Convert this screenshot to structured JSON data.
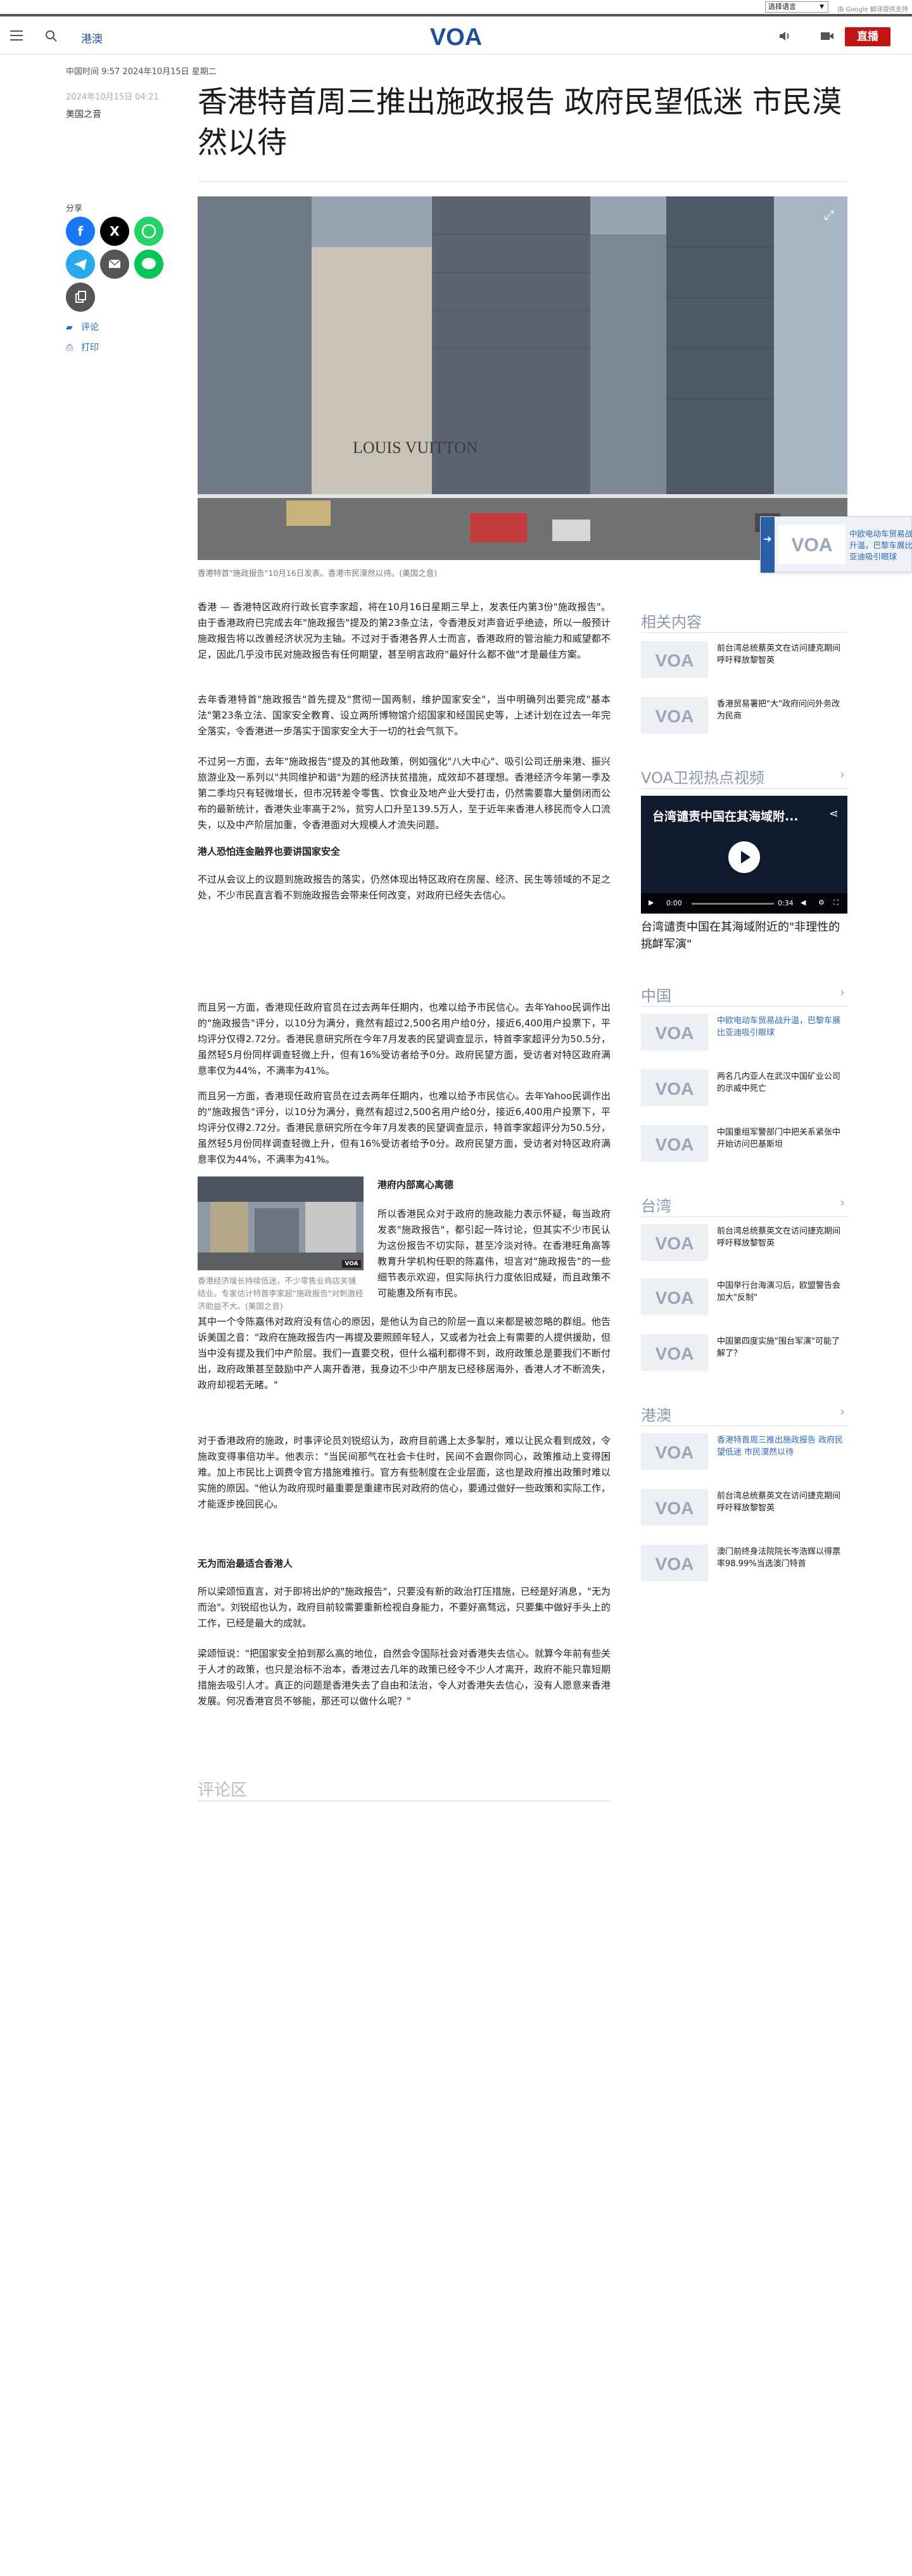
{
  "topbar": {
    "language_select": "选择语言",
    "powered_by": "由 Google 翻译提供支持"
  },
  "header": {
    "section": "港澳",
    "logo_text": "VOA",
    "live_label": "直播"
  },
  "article": {
    "meta_time": "中国时间 9:57 2024年10月15日 星期二",
    "date": "2024年10月15日 04:21",
    "byline": "美国之音",
    "headline": "香港特首周三推出施政报告 政府民望低迷 市民漠然以待",
    "hero_caption": "香港特首\"施政报告\"10月16日发表。香港市民漠然以待。(美国之音)",
    "inline_caption": "香港经济增长持续低迷，不少零售业商店关铺结业。专家估计特首李家超\"施政报告\"对刺激经济助益不大。(美国之音)",
    "paragraphs": [
      "香港 — 香港特区政府行政长官李家超，将在10月16日星期三早上，发表任内第3份\"施政报告\"。由于香港政府已完成去年\"施政报告\"提及的第23条立法，令香港反对声音近乎绝迹，所以一般预计施政报告将以改善经济状况为主轴。不过对于香港各界人士而言，香港政府的管治能力和威望都不足，因此几乎没市民对施政报告有任何期望，甚至明言政府\"最好什么都不做\"才是最佳方案。",
      "去年香港特首\"施政报告\"首先提及\"贯彻一国两制，维护国家安全\"，当中明确列出要完成\"基本法\"第23条立法、国家安全教育、设立两所博物馆介绍国家和经国民史等，上述计划在过去一年完全落实，令香港进一步落实于国家安全大于一切的社会气氛下。",
      "不过另一方面，去年\"施政报告\"提及的其他政策，例如强化\"八大中心\"、吸引公司迁册来港、振兴旅游业及一系列以\"共同维护和谐\"为题的经济扶贫措施，成效却不甚理想。香港经济今年第一季及第二季均只有轻微增长，但市况转差令零售、饮食业及地产业大受打击，仍然需要靠大量倒闭而公布的最新统计，香港失业率高于2%，贫穷人口升至139.5万人，至于近年来香港人移民而令人口流失，以及中产阶层加重，令香港面对大规模人才流失问题。",
      "不过从会议上的议题到施政报告的落实，仍然体现出特区政府在房屋、经济、民生等领域的不足之处，不少市民直言看不到施政报告会带来任何改变，对政府已经失去信心。",
      "而且另一方面，香港现任政府官员在过去两年任期内，也难以给予市民信心。去年Yahoo民调作出的\"施政报告\"评分，以10分为满分，竟然有超过2,500名用户给0分，接近6,400用户投票下，平均评分仅得2.72分。香港民意研究所在今年7月发表的民望调查显示，特首李家超评分为50.5分，虽然轻5月份同样调查轻微上升，但有16%受访者给予0分。政府民望方面，受访者对特区政府满意率仅为44%，不满率为41%。",
      "所以香港民众对于政府的施政能力表示怀疑，每当政府发表\"施政报告\"，都引起一阵讨论，但其实不少市民认为这份报告不切实际，甚至冷淡对待。在香港旺角高等教育升学机构任职的陈嘉伟，坦言对\"施政报告\"的一些细节表示欢迎，但实际执行力度依旧成疑，而且政策不可能惠及所有市民。",
      "其中一个令陈嘉伟对政府没有信心的原因，是他认为自己的阶层一直以来都是被忽略的群组。他告诉美国之音：\"政府在施政报告内一再提及要照顾年轻人，又或者为社会上有需要的人提供援助，但当中没有提及我们中产阶层。我们一直要交税，但什么福利都得不到，政府政策总是要我们不断付出，政府政策甚至鼓励中产人离开香港，我身边不少中产朋友已经移居海外，香港人才不断流失，政府却视若无睹。\"",
      "对于香港政府的施政，时事评论员刘锐绍认为，政府目前遇上太多掣肘，难以让民众看到成效，令施政变得事倍功半。他表示：\"当民间那气在社会卡住时，民间不会跟你同心，政策推动上变得困难。加上市民比上调费令官方措施难推行。官方有些制度在企业层面，这也是政府推出政策时难以实施的原因。\"他认为政府现时最重要是重建市民对政府的信心，要通过做好一些政策和实际工作，才能逐步挽回民心。",
      "所以梁颂恒直言，对于即将出炉的\"施政报告\"，只要没有新的政治打压措施，已经是好消息，\"无为而治\"。刘锐绍也认为，政府目前较需要重新检视自身能力，不要好高骛远，只要集中做好手头上的工作，已经是最大的成就。",
      "梁颂恒说：\"把国家安全拍到那么高的地位，自然会令国际社会对香港失去信心。就算今年前有些关于人才的政策，也只是治标不治本，香港过去几年的政策已经令不少人才离开，政府不能只靠短期措施去吸引人才。真正的问题是香港失去了自由和法治，令人对香港失去信心，没有人愿意来香港发展。何况香港官员不够能，那还可以做什么呢？\""
    ],
    "subheads": [
      "港人恐怕连金融界也要讲国家安全",
      "港府内部离心离德",
      "无为而治最适合香港人"
    ],
    "comments_head": "评论区"
  },
  "share": {
    "label": "分享",
    "comment_label": "评论",
    "print_label": "打印"
  },
  "float_widget": {
    "text": "中欧电动车贸易战升温，巴黎车展比亚迪吸引眼球"
  },
  "right_column": {
    "related_head": "相关内容",
    "related": [
      "前台湾总统蔡英文在访问捷克期间呼吁释放黎智英",
      "香港贸易署把\"大\"政府问问外务改为民商"
    ],
    "video_head": "VOA卫视热点视频",
    "video_overlay_title": "台湾谴责中国在其海域附...",
    "video_time": "0:00",
    "video_duration": "0:34",
    "video_title": "台湾谴责中国在其海域附近的\"非理性的挑衅军演\"",
    "china_head": "中国",
    "china": [
      "中欧电动车贸易战升温，巴黎车展比亚迪吸引眼球",
      "两名几内亚人在武汉中国矿业公司的示威中死亡",
      "中国重组军警部门中把关系紧张中开始访问巴基斯坦"
    ],
    "taiwan_head": "台湾",
    "taiwan": [
      "前台湾总统蔡英文在访问捷克期间呼吁释放黎智英",
      "中国举行台海演习后，欧盟警告会加大\"反制\"",
      "中国第四度实施\"围台军演\"可能了解了？"
    ],
    "hk_head": "港澳",
    "hk": [
      "香港特首周三推出施政报告 政府民望低迷 市民漠然以待",
      "前台湾总统蔡英文在访问捷克期间呼吁释放黎智英",
      "澳门前终身法院院长岑浩辉以得票率98.99%当选澳门特首"
    ]
  },
  "colors": {
    "brand_blue": "#1e4f9c",
    "live_red": "#c31414",
    "link_blue": "#2b6ab5"
  }
}
